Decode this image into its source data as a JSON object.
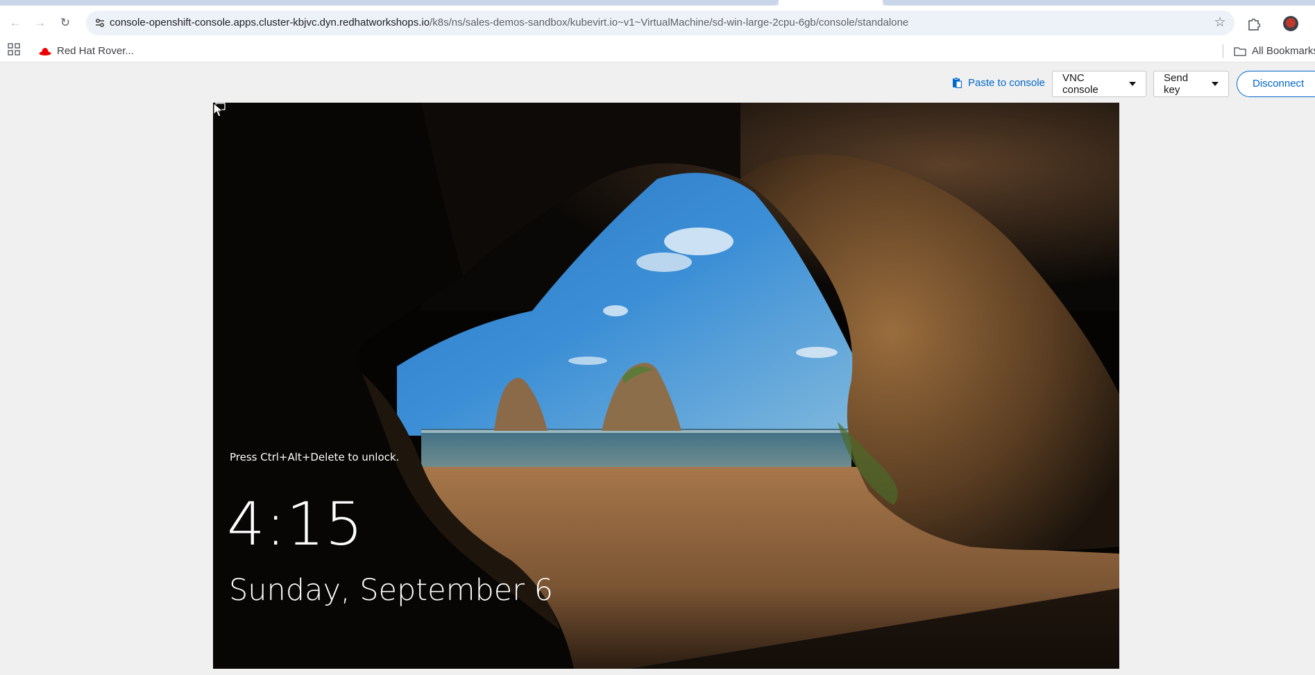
{
  "browser": {
    "url_host": "console-openshift-console.apps.cluster-kbjvc.dyn.redhatworkshops.io",
    "url_path": "/k8s/ns/sales-demos-sandbox/kubevirt.io~v1~VirtualMachine/sd-win-large-2cpu-6gb/console/standalone",
    "icons": {
      "back": "arrow-left-icon",
      "forward": "arrow-right-icon",
      "reload": "reload-icon",
      "site_info": "tune-icon",
      "bookmark_star": "star-icon",
      "extensions": "puzzle-icon",
      "profile": "avatar"
    },
    "bookmarks": {
      "items": [
        {
          "label": "Red Hat Rover...",
          "icon": "red-hat-icon"
        }
      ],
      "all_bookmarks_label": "All Bookmarks"
    }
  },
  "console_toolbar": {
    "paste_label": "Paste to console",
    "console_type": "VNC console",
    "send_key_label": "Send key",
    "disconnect_label": "Disconnect"
  },
  "lock_screen": {
    "unlock_message": "Press Ctrl+Alt+Delete to unlock.",
    "time": "4:15",
    "date": "Sunday, September 6"
  },
  "colors": {
    "link_blue": "#0066cc",
    "omnibox_bg": "#edf1f8",
    "page_bg": "#f0f0f0"
  }
}
